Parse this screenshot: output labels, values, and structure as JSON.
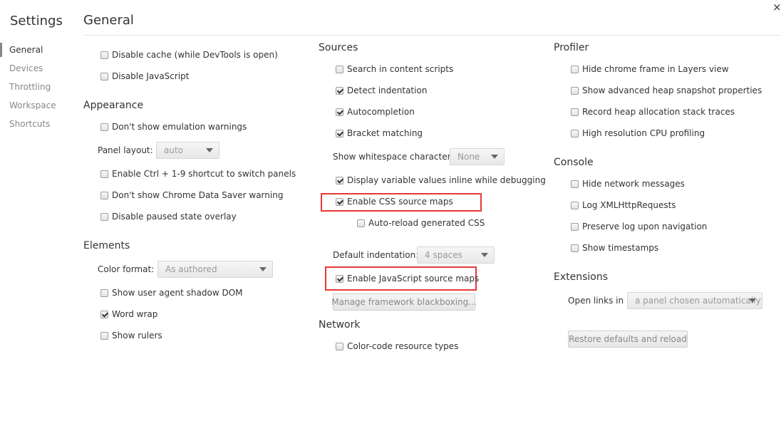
{
  "sidebar": {
    "title": "Settings",
    "items": [
      {
        "label": "General"
      },
      {
        "label": "Devices"
      },
      {
        "label": "Throttling"
      },
      {
        "label": "Workspace"
      },
      {
        "label": "Shortcuts"
      }
    ]
  },
  "header": {
    "title": "General",
    "close_glyph": "×"
  },
  "col1": {
    "top_options": [
      "Disable cache (while DevTools is open)",
      "Disable JavaScript"
    ],
    "appearance": {
      "title": "Appearance",
      "dont_show_emulation": "Don't show emulation warnings",
      "panel_layout_label": "Panel layout:",
      "panel_layout_value": "auto",
      "ctrl_shortcut": "Enable Ctrl + 1-9 shortcut to switch panels",
      "data_saver": "Don't show Chrome Data Saver warning",
      "paused_overlay": "Disable paused state overlay"
    },
    "elements": {
      "title": "Elements",
      "color_format_label": "Color format:",
      "color_format_value": "As authored",
      "shadow_dom": "Show user agent shadow DOM",
      "word_wrap": "Word wrap",
      "show_rulers": "Show rulers"
    }
  },
  "col2": {
    "sources": {
      "title": "Sources",
      "search_content_scripts": "Search in content scripts",
      "detect_indentation": "Detect indentation",
      "autocompletion": "Autocompletion",
      "bracket_matching": "Bracket matching",
      "whitespace_label": "Show whitespace characters:",
      "whitespace_value": "None",
      "inline_values": "Display variable values inline while debugging",
      "css_source_maps": "Enable CSS source maps",
      "auto_reload_css": "Auto-reload generated CSS",
      "indentation_label": "Default indentation:",
      "indentation_value": "4 spaces",
      "js_source_maps": "Enable JavaScript source maps",
      "blackboxing_button": "Manage framework blackboxing..."
    },
    "network": {
      "title": "Network",
      "color_code": "Color-code resource types"
    }
  },
  "col3": {
    "profiler": {
      "title": "Profiler",
      "hide_chrome_frame": "Hide chrome frame in Layers view",
      "advanced_heap": "Show advanced heap snapshot properties",
      "record_heap": "Record heap allocation stack traces",
      "high_res_cpu": "High resolution CPU profiling"
    },
    "console": {
      "title": "Console",
      "hide_network": "Hide network messages",
      "log_xhr": "Log XMLHttpRequests",
      "preserve_log": "Preserve log upon navigation",
      "show_timestamps": "Show timestamps"
    },
    "extensions": {
      "title": "Extensions",
      "open_links_label": "Open links in",
      "open_links_value": "a panel chosen automatically"
    },
    "restore_button": "Restore defaults and reload"
  },
  "colors": {
    "highlight": "#e53935",
    "text": "#333333",
    "muted": "#888888"
  }
}
